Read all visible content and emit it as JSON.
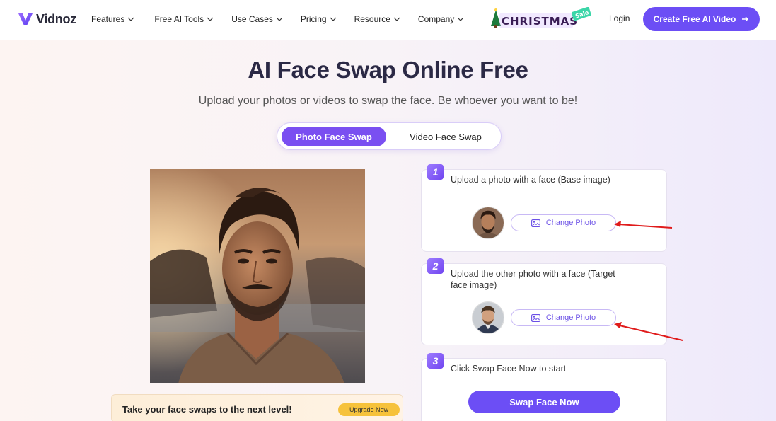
{
  "nav": {
    "logo": "Vidnoz",
    "menu": [
      {
        "label": "Features"
      },
      {
        "label": "Free AI Tools"
      },
      {
        "label": "Use Cases"
      },
      {
        "label": "Pricing"
      },
      {
        "label": "Resource"
      },
      {
        "label": "Company"
      }
    ],
    "promo": {
      "main": "CHRISTMAS",
      "tag": "Sale"
    },
    "login": "Login",
    "cta": "Create Free AI Video"
  },
  "hero": {
    "title": "AI Face Swap Online Free",
    "subtitle": "Upload your photos or videos to swap the face. Be whoever you want to be!"
  },
  "tabs": [
    {
      "label": "Photo Face Swap",
      "active": true
    },
    {
      "label": "Video Face Swap",
      "active": false
    }
  ],
  "upgrade": {
    "text": "Take your face swaps to the next level!",
    "button": "Upgrade Now"
  },
  "steps": [
    {
      "num": "1",
      "text": "Upload a photo with a face (Base image)",
      "button": "Change Photo"
    },
    {
      "num": "2",
      "text": "Upload the other photo with a face (Target face image)",
      "button": "Change Photo"
    },
    {
      "num": "3",
      "text": "Click Swap Face Now to start",
      "button": "Swap Face Now"
    }
  ],
  "colors": {
    "brand": "#6c4ef5",
    "upgrade": "#f6c23b",
    "annotation_arrow": "#e01b1b"
  }
}
